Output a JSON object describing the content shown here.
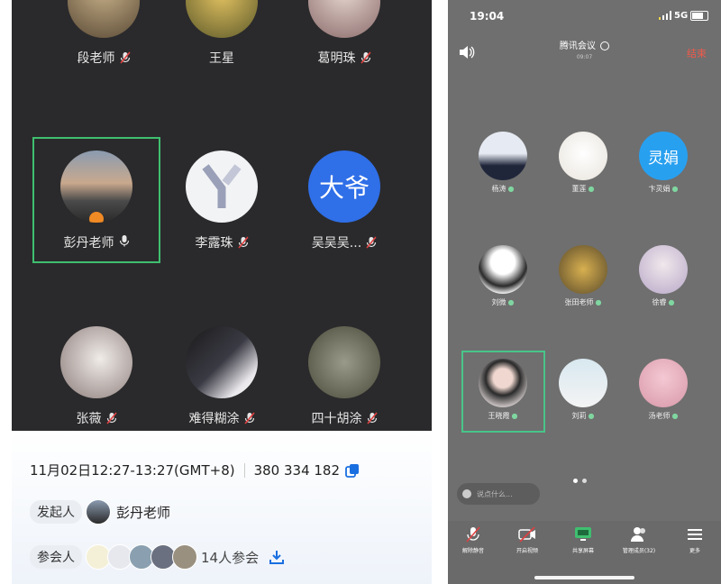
{
  "left": {
    "participants": [
      {
        "name": "段老师",
        "muted": true
      },
      {
        "name": "王星",
        "muted": false
      },
      {
        "name": "葛明珠",
        "muted": true
      },
      {
        "name": "彭丹老师",
        "muted": false,
        "host": true,
        "active": true
      },
      {
        "name": "李露珠",
        "muted": true
      },
      {
        "name": "吴吴吴...",
        "muted": true,
        "avatar_text": "大爷"
      },
      {
        "name": "张薇",
        "muted": true
      },
      {
        "name": "难得糊涂",
        "muted": true
      },
      {
        "name": "四十胡涂",
        "muted": true
      }
    ],
    "info": {
      "time": "11月02日12:27-13:27(GMT+8)",
      "meeting_id": "380 334 182",
      "organizer_label": "发起人",
      "organizer_name": "彭丹老师",
      "attendees_label": "参会人",
      "attendees_count": "14人参会"
    },
    "colors": {
      "grid_bg": "#2a2a2c",
      "active_border": "#3fbf6f",
      "accent": "#1a6fe0"
    }
  },
  "right": {
    "status_time": "19:04",
    "status_network": "5G",
    "title": "腾讯会议",
    "subtitle": "09:07",
    "end_label": "结束",
    "participants": [
      {
        "name": "杨涛"
      },
      {
        "name": "董莲"
      },
      {
        "name": "卞灵娟",
        "avatar_text": "灵娟"
      },
      {
        "name": "刘微"
      },
      {
        "name": "张田老师"
      },
      {
        "name": "徐睿"
      },
      {
        "name": "王晓霞",
        "active": true
      },
      {
        "name": "刘莉"
      },
      {
        "name": "汤老师"
      }
    ],
    "chat_placeholder": "说点什么...",
    "toolbar": [
      {
        "label": "解除静音",
        "icon": "mic-off-icon"
      },
      {
        "label": "开启视频",
        "icon": "video-off-icon"
      },
      {
        "label": "共享屏幕",
        "icon": "share-screen-icon"
      },
      {
        "label": "管理成员(32)",
        "icon": "members-icon"
      },
      {
        "label": "更多",
        "icon": "more-icon"
      }
    ]
  }
}
